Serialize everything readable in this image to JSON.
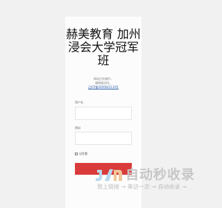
{
  "login": {
    "title": "赫美教育 加州浸会大学冠军班",
    "notice_line1": "网站正在维护。",
    "notice_line2": "请稍候访问。",
    "notice_link": "辽ICP备2000642114号",
    "username_label": "用户名",
    "password_label": "密码",
    "remember_label": "记住我",
    "colors": {
      "button": "#d93b3b",
      "link": "#2a5ea8"
    }
  },
  "watermark": {
    "title": "自动秒收录",
    "subtitle": "致上链接 → 来访一次 → 自动收录 →"
  }
}
